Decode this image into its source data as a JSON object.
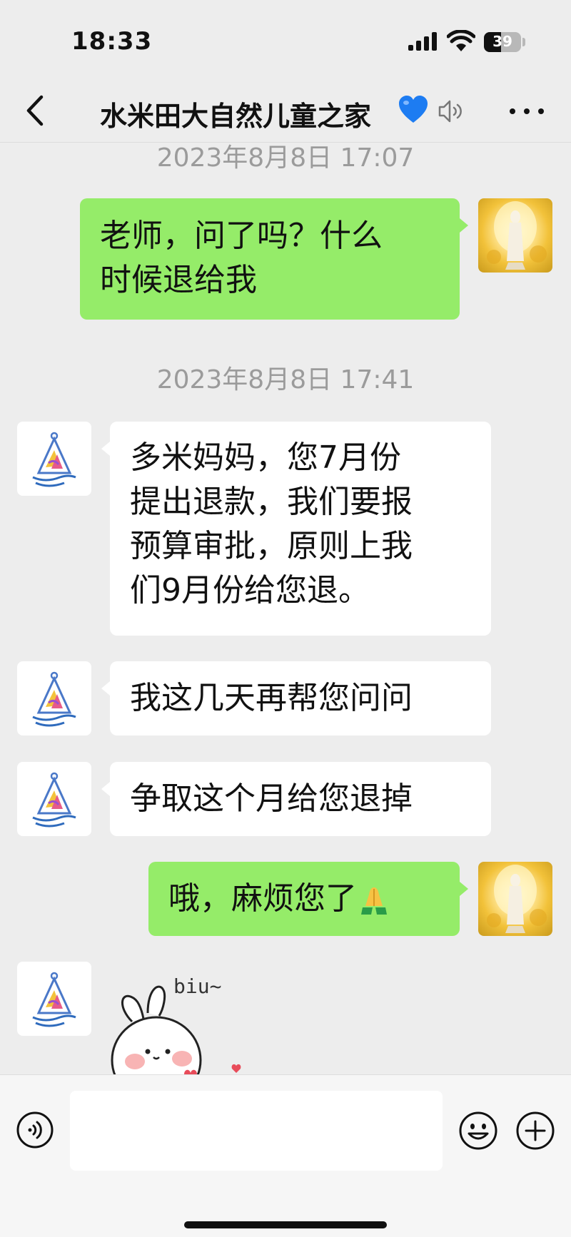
{
  "status_bar": {
    "time": "18:33",
    "battery": "39",
    "icons": [
      "signal-icon",
      "wifi-icon",
      "battery-icon"
    ]
  },
  "header": {
    "title": "水米田大自然儿童之家",
    "title_emoji": "blue-heart-icon",
    "icons": [
      "back-arrow-icon",
      "mute-speaker-icon",
      "more-icon"
    ]
  },
  "messages": [
    {
      "type": "timestamp",
      "text": "2023年8月8日 17:07"
    },
    {
      "type": "outgoing",
      "lines": [
        "老师，问了吗？什么",
        "时候退给我"
      ]
    },
    {
      "type": "timestamp",
      "text": "2023年8月8日 17:41"
    },
    {
      "type": "incoming",
      "lines": [
        "多米妈妈，您7月份",
        "提出退款，我们要报",
        "预算审批，原则上我",
        "们9月份给您退。"
      ]
    },
    {
      "type": "incoming",
      "lines": [
        "我这几天再帮您问问"
      ]
    },
    {
      "type": "incoming",
      "lines": [
        "争取这个月给您退掉"
      ]
    },
    {
      "type": "outgoing",
      "lines": [
        "哦，麻烦您了"
      ],
      "emoji": "folded-hands-icon"
    },
    {
      "type": "incoming-sticker",
      "text": "biu~",
      "sticker": "bunny-sticker"
    }
  ],
  "input_bar": {
    "placeholder": "",
    "icons": [
      "voice-icon",
      "emoji-icon",
      "plus-icon"
    ]
  },
  "colors": {
    "background": "#ededed",
    "outgoing_bubble": "#95ec69",
    "incoming_bubble": "#ffffff",
    "timestamp_text": "#9b9b9b",
    "heart": "#1d7cf2"
  }
}
